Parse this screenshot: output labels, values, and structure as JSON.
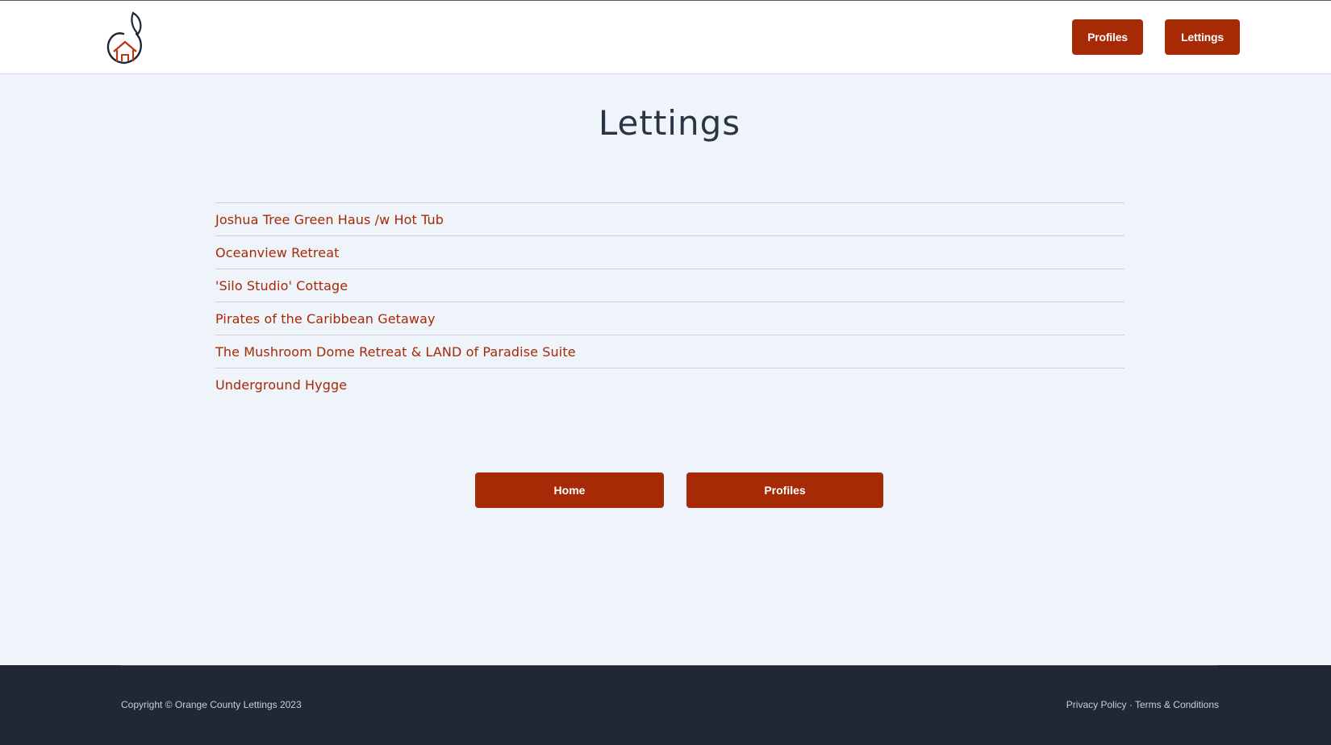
{
  "header": {
    "logo_icon": "orange-house-logo-icon",
    "nav": {
      "profiles_label": "Profiles",
      "lettings_label": "Lettings"
    }
  },
  "main": {
    "title": "Lettings",
    "lettings": [
      "Joshua Tree Green Haus /w Hot Tub",
      "Oceanview Retreat",
      "'Silo Studio' Cottage",
      "Pirates of the Caribbean Getaway",
      "The Mushroom Dome Retreat & LAND of Paradise Suite",
      "Underground Hygge"
    ],
    "buttons": {
      "home_label": "Home",
      "profiles_label": "Profiles"
    }
  },
  "footer": {
    "copyright": "Copyright © Orange County Lettings 2023",
    "privacy_label": "Privacy Policy",
    "separator": "·",
    "terms_label": "Terms & Conditions"
  },
  "colors": {
    "accent": "#a52a05",
    "background": "#eff3fa",
    "footer": "#212834",
    "title_text": "#2b3443"
  }
}
